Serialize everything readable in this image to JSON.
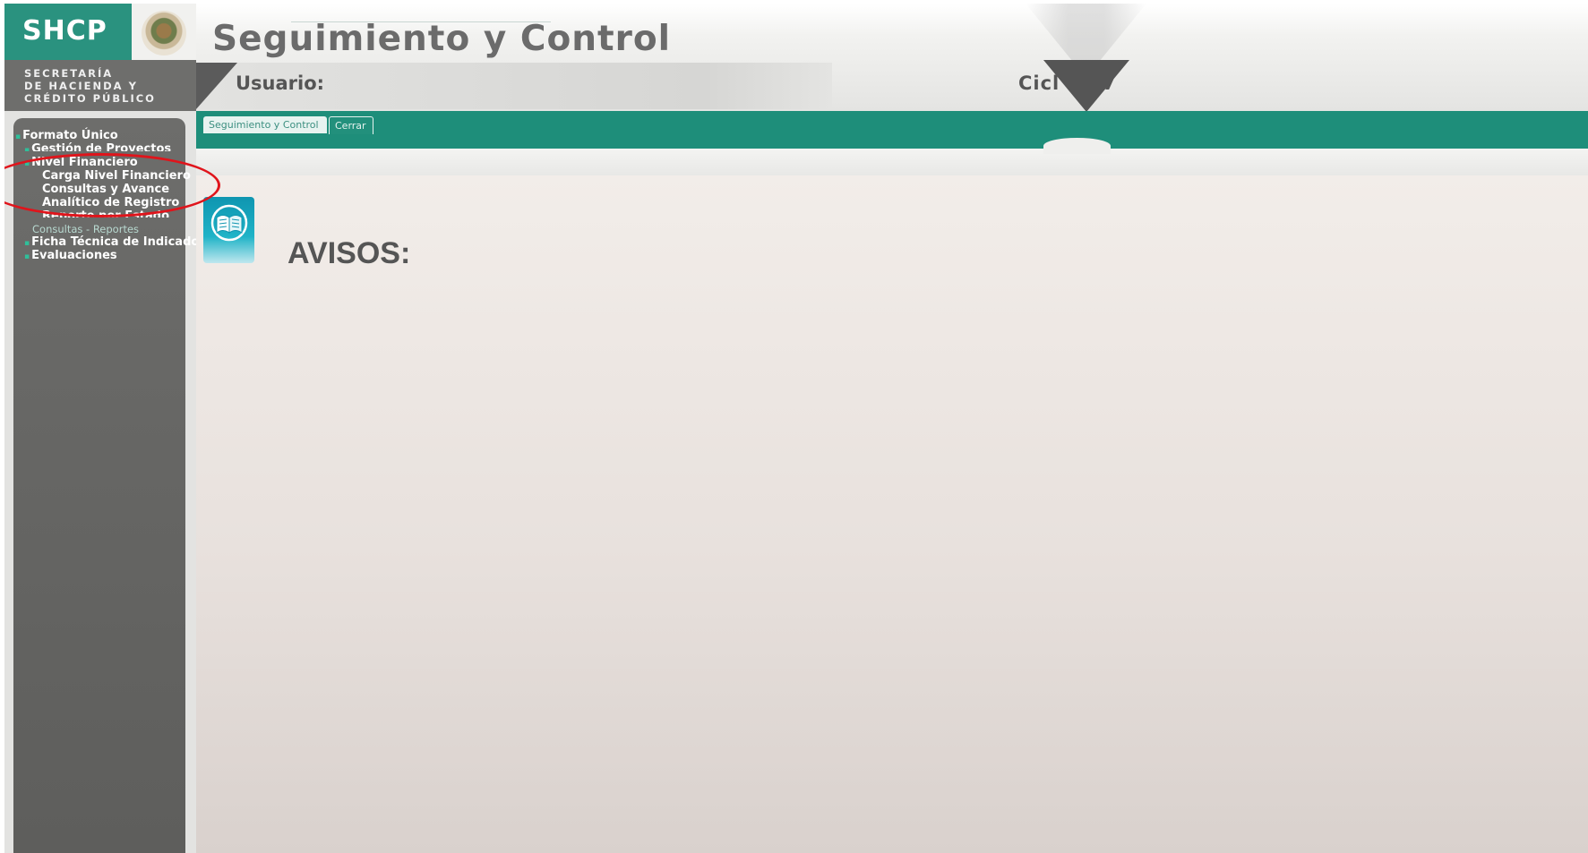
{
  "branding": {
    "logo": "SHCP",
    "secretaria_lines": [
      "SECRETARÍA",
      "DE HACIENDA Y",
      "CRÉDITO PÚBLICO"
    ],
    "seal_icon": "mexican-coat-of-arms-icon"
  },
  "header": {
    "title": "Seguimiento y Control",
    "user_label": "Usuario:",
    "ciclo_label": "Cicl   20 7"
  },
  "tabs": [
    {
      "label": "Seguimiento y Control"
    },
    {
      "label": "Cerrar"
    }
  ],
  "sidebar": {
    "items": [
      {
        "label": "Formato Único"
      },
      {
        "label": "Gestión de Proyectos"
      },
      {
        "label": "Nivel Financiero"
      },
      {
        "label": "Carga Nivel Financiero"
      },
      {
        "label": "Consultas y Avance"
      },
      {
        "label": "Analítico de Registro"
      },
      {
        "label": "Reporte por Estado"
      },
      {
        "label": "Consultas - Reportes"
      },
      {
        "label": "Ficha Técnica de Indicadores"
      },
      {
        "label": "Evaluaciones"
      }
    ]
  },
  "main": {
    "notice_heading": "AVISOS:",
    "notice_icon": "book-icon"
  },
  "colors": {
    "brand_green": "#2a927f",
    "nav_green": "#1e8e7a",
    "annotation_red": "#e0141b"
  }
}
